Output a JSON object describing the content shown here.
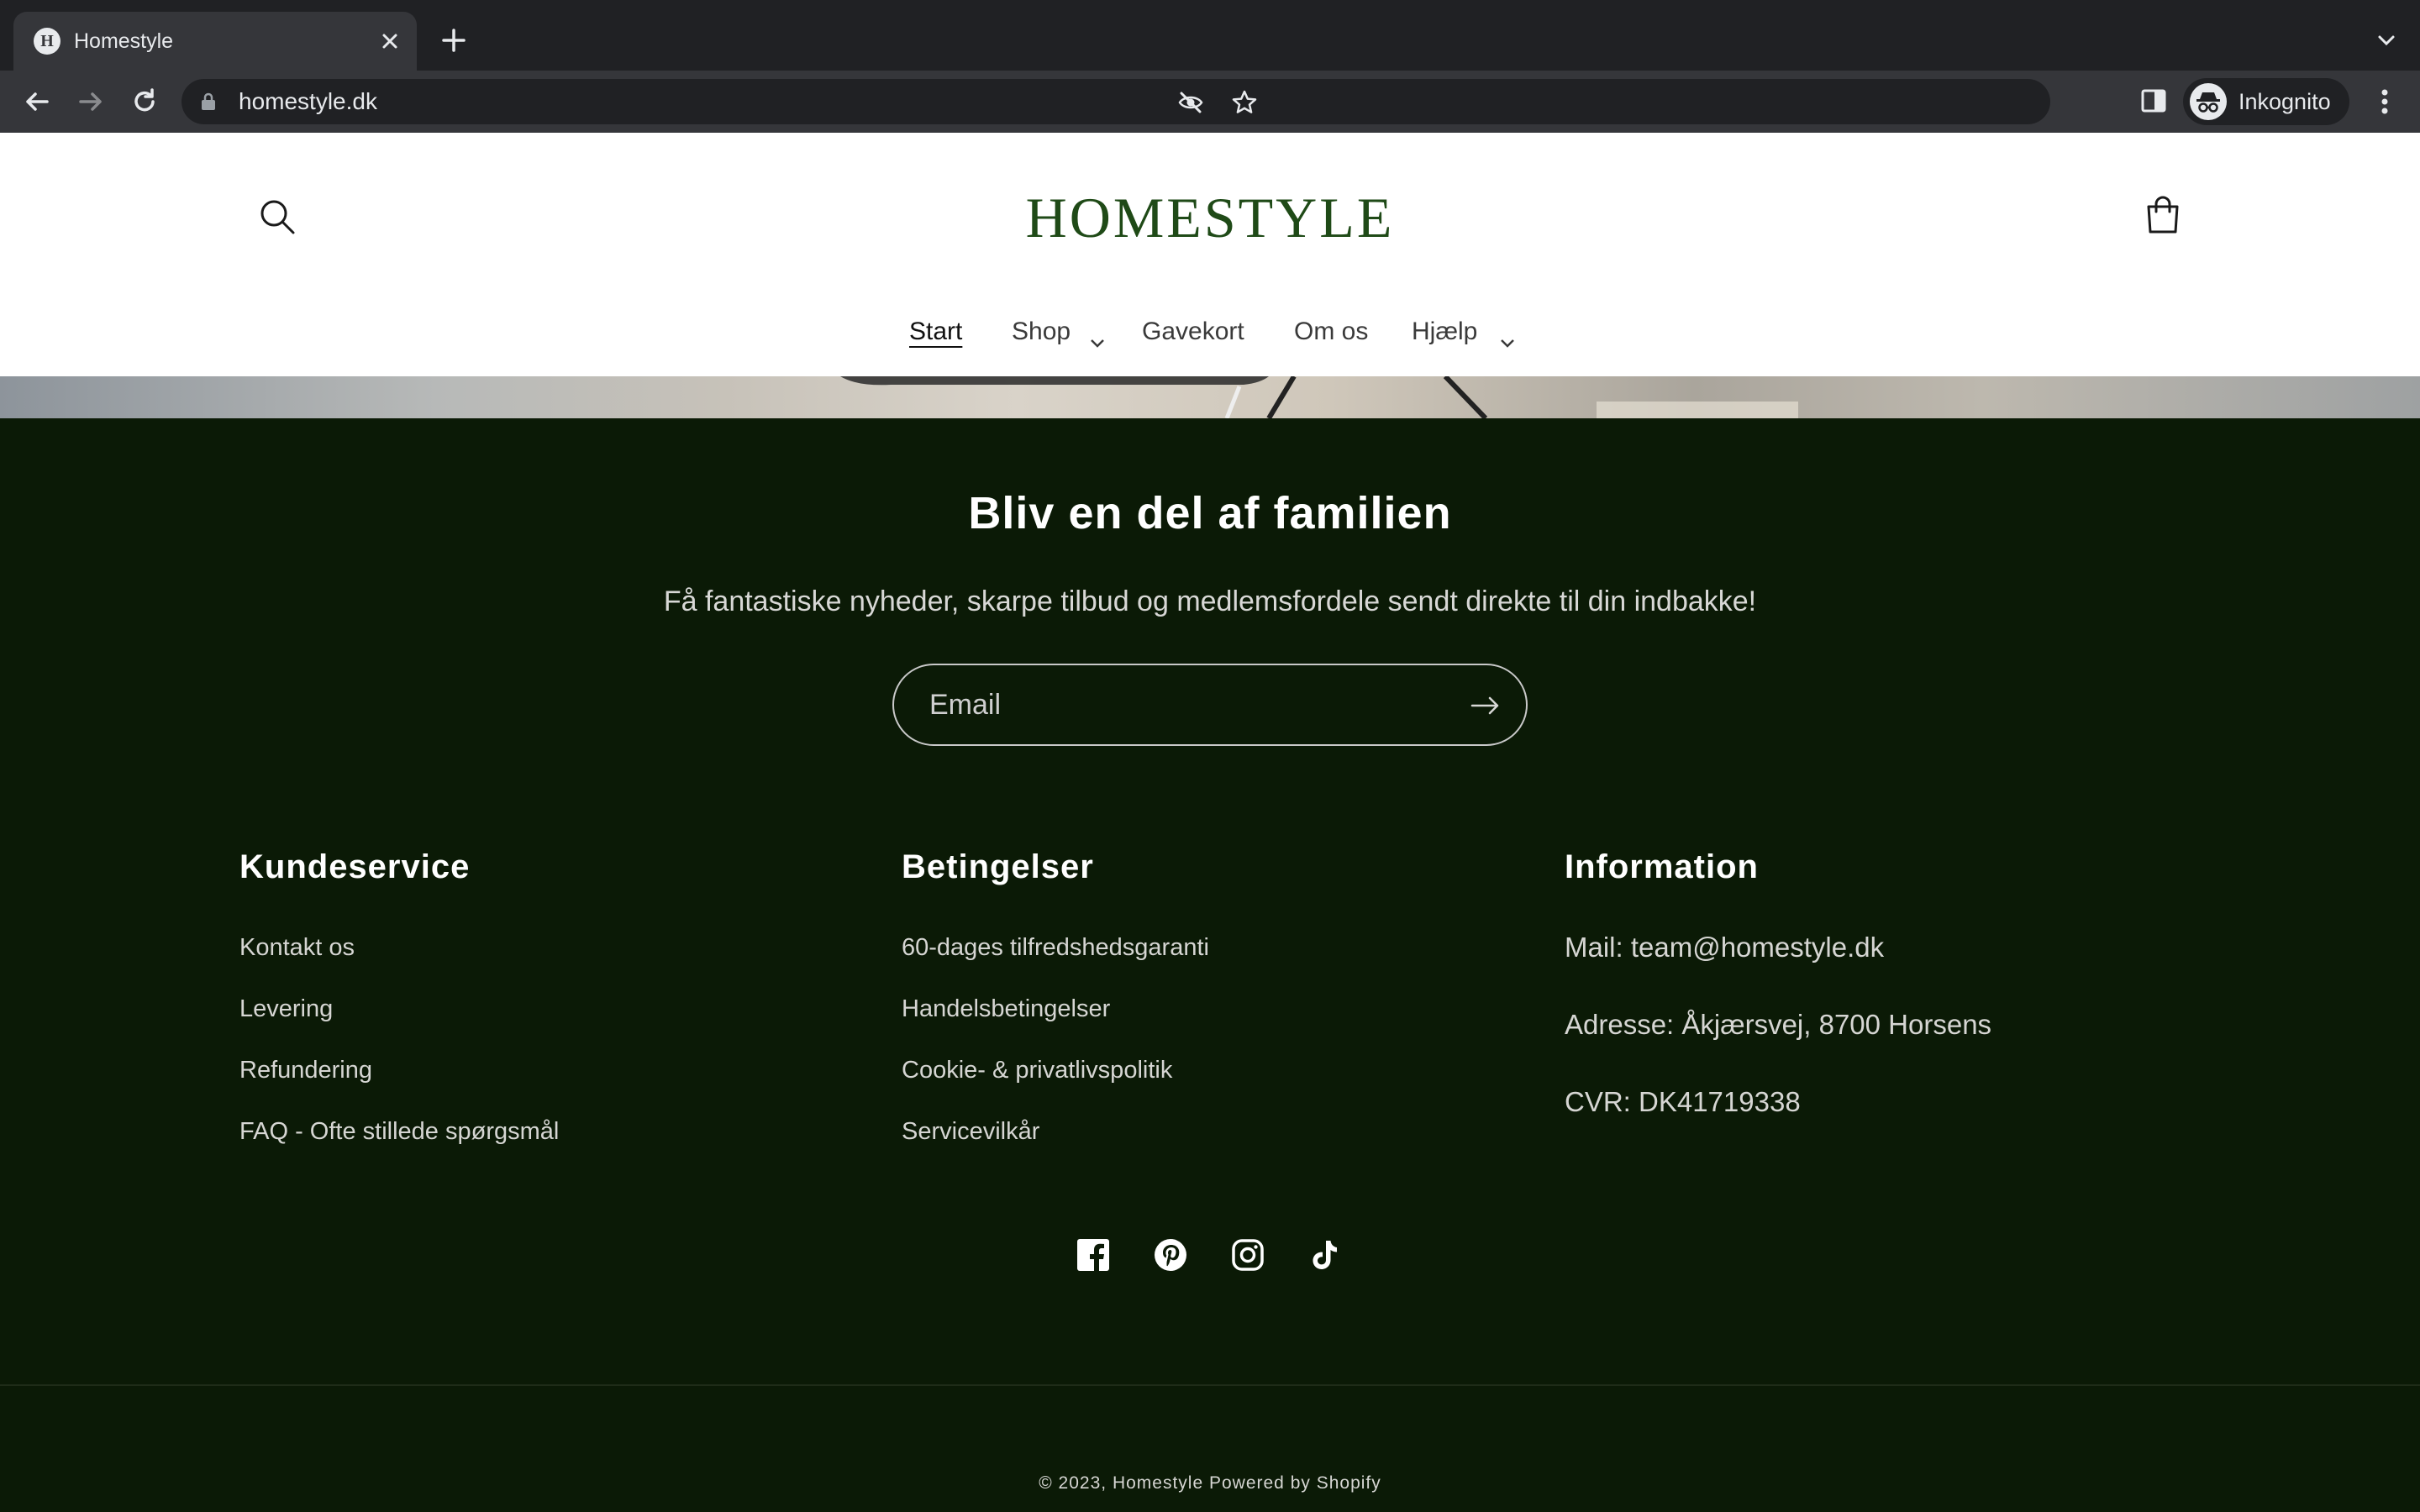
{
  "browser": {
    "tab_title": "Homestyle",
    "tab_favicon_letter": "H",
    "url": "homestyle.dk",
    "profile_label": "Inkognito"
  },
  "header": {
    "logo": "HOMESTYLE",
    "nav": [
      {
        "label": "Start",
        "active": true
      },
      {
        "label": "Shop",
        "has_dropdown": true
      },
      {
        "label": "Gavekort"
      },
      {
        "label": "Om os"
      },
      {
        "label": "Hjælp",
        "has_dropdown": true
      }
    ]
  },
  "newsletter": {
    "title": "Bliv en del af familien",
    "subtitle": "Få fantastiske nyheder, skarpe tilbud og medlemsfordele sendt direkte til din indbakke!",
    "email_placeholder": "Email"
  },
  "footer": {
    "columns": [
      {
        "heading": "Kundeservice",
        "links": [
          "Kontakt os",
          "Levering",
          "Refundering",
          "FAQ - Ofte stillede spørgsmål"
        ]
      },
      {
        "heading": "Betingelser",
        "links": [
          "60-dages tilfredshedsgaranti",
          "Handelsbetingelser",
          "Cookie- & privatlivspolitik",
          "Servicevilkår"
        ]
      },
      {
        "heading": "Information",
        "lines": [
          "Mail: team@homestyle.dk",
          "Adresse: Åkjærsvej, 8700 Horsens",
          "CVR: DK41719338"
        ]
      }
    ],
    "social_icons": [
      "facebook-icon",
      "pinterest-icon",
      "instagram-icon",
      "tiktok-icon"
    ],
    "copyright": "© 2023, Homestyle Powered by Shopify"
  },
  "colors": {
    "footer_bg": "#0b1a06",
    "logo_green": "#1f4a17",
    "chrome_dark": "#202124",
    "chrome_mid": "#35363a"
  }
}
